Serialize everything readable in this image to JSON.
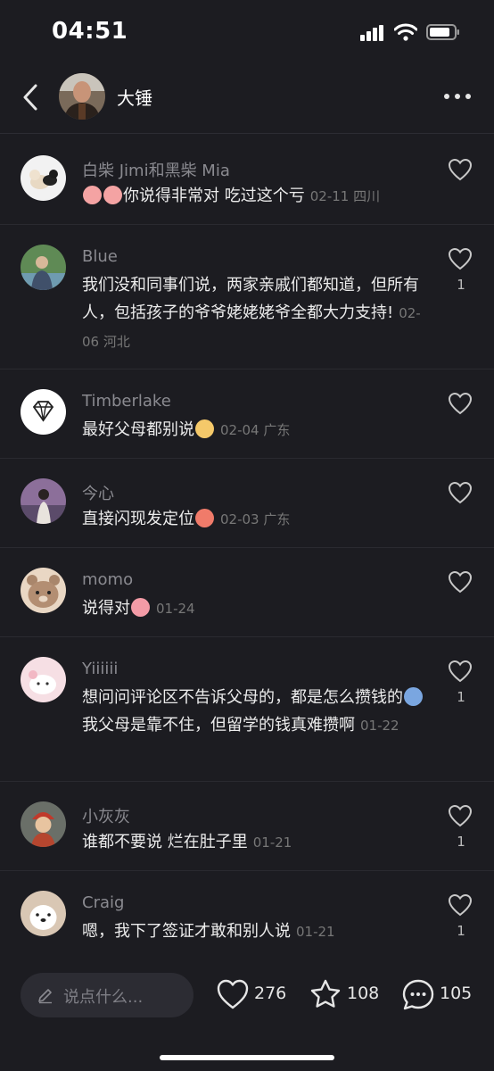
{
  "status_bar": {
    "time": "04:51"
  },
  "header": {
    "username": "大锤"
  },
  "comments": [
    {
      "user": "白柴 Jimi和黑柴 Mia",
      "text": "你说得非常对 吃过这个亏",
      "date": "02-11 四川",
      "likes": ""
    },
    {
      "user": "Blue",
      "text": "我们没和同事们说，两家亲戚们都知道，但所有人，包括孩子的爷爷姥姥姥爷全都大力支持!",
      "date": "02-06 河北",
      "likes": "1"
    },
    {
      "user": "Timberlake",
      "text": "最好父母都别说",
      "date": "02-04 广东",
      "likes": ""
    },
    {
      "user": "今心",
      "text": "直接闪现发定位",
      "date": "02-03 广东",
      "likes": ""
    },
    {
      "user": "momo",
      "text": "说得对",
      "date": "01-24",
      "likes": ""
    },
    {
      "user": "Yiiiiii",
      "text_part1": "想问问评论区不告诉父母的，都是怎么攒钱的",
      "text_part2": "我父母是靠不住，但留学的钱真难攒啊",
      "date": "01-22",
      "likes": "1"
    },
    {
      "user": "小灰灰",
      "text": "谁都不要说 烂在肚子里",
      "date": "01-21",
      "likes": "1"
    },
    {
      "user": "Craig",
      "text": "嗯，我下了签证才敢和别人说",
      "date": "01-21",
      "likes": "1"
    }
  ],
  "bottom_bar": {
    "input_placeholder": "说点什么...",
    "likes": "276",
    "favorites": "108",
    "comments": "105"
  },
  "icons": [
    "back-icon",
    "more-icon",
    "heart-icon",
    "star-icon",
    "comment-icon",
    "pencil-icon",
    "signal-icon",
    "wifi-icon",
    "battery-icon"
  ],
  "colors": {
    "background": "#1c1c21",
    "text": "#ececec",
    "secondary": "#8a8a90",
    "input_bg": "#2c2c33"
  }
}
